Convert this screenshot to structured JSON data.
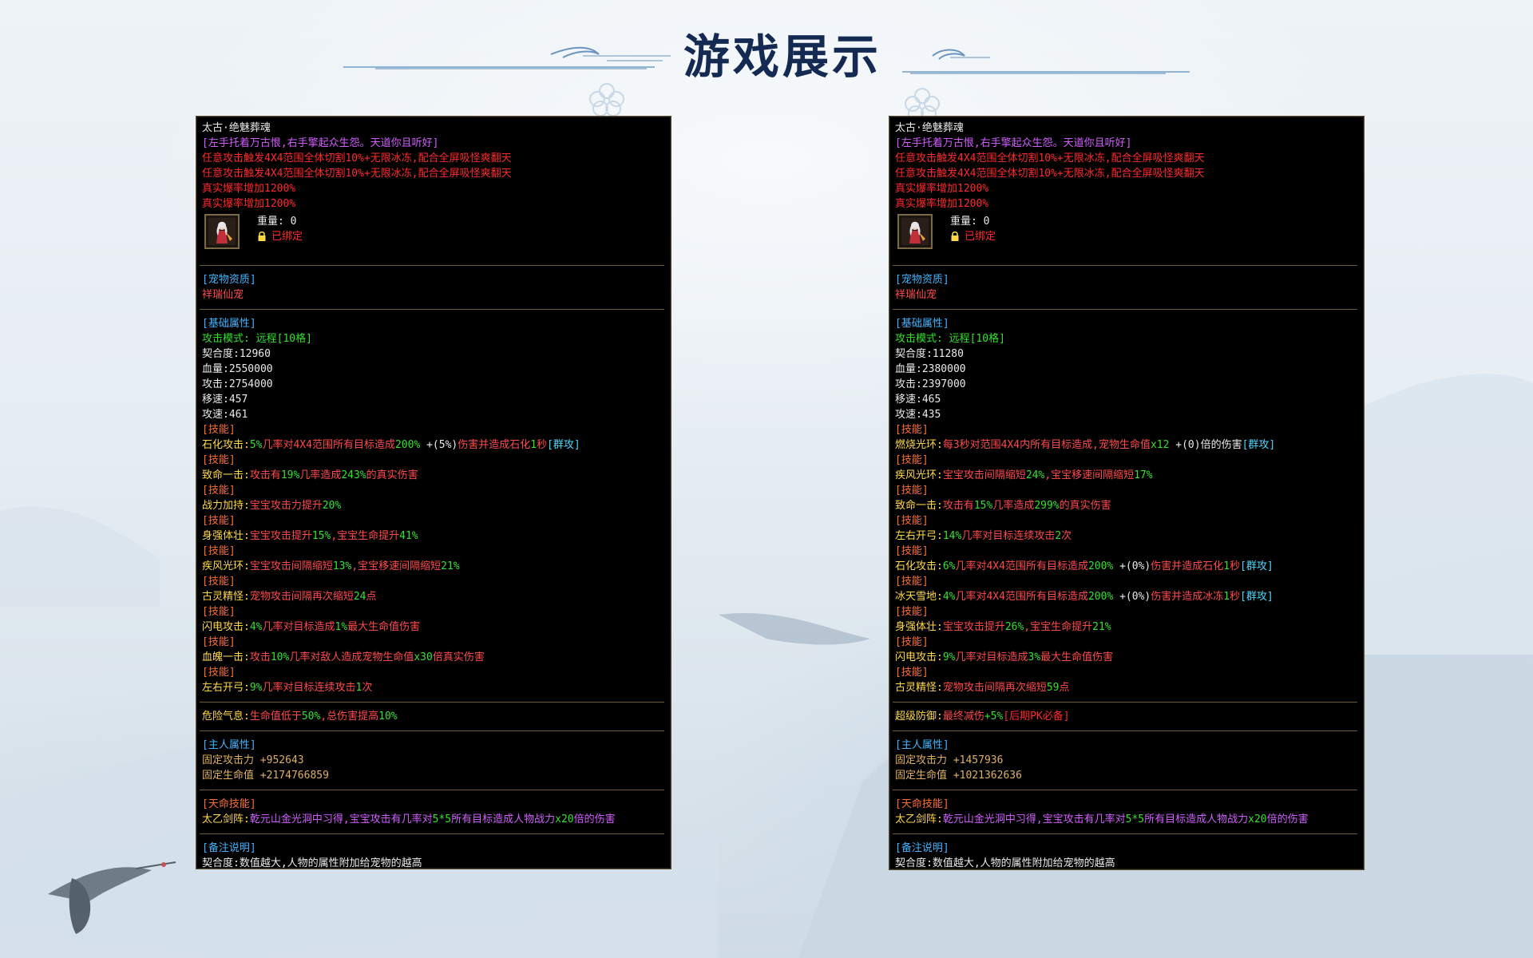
{
  "page_title": "游戏展示",
  "panels": [
    {
      "item_name": "太古·绝魅葬魂",
      "motto": "[左手托着万古恨,右手擎起众生怨。天道你且听好]",
      "effect_1": "任意攻击触发4X4范围全体切割10%+无限冰冻,配合全屏吸怪爽翻天",
      "effect_2": "任意攻击触发4X4范围全体切割10%+无限冰冻,配合全屏吸怪爽翻天",
      "crit_1": "真实爆率增加1200%",
      "crit_2": "真实爆率增加1200%",
      "weight_label": "重量: 0",
      "bound_label": "已绑定",
      "section_quality": "[宠物资质]",
      "quality_value": "祥瑞仙宠",
      "section_base": "[基础属性]",
      "attack_mode": "攻击模式: 远程[10格]",
      "stats": [
        "契合度:12960",
        "血量:2550000",
        "攻击:2754000",
        "移速:457",
        "攻速:461"
      ],
      "skill_label": "[技能]",
      "skills": [
        {
          "name": "石化攻击:",
          "p1": "5%",
          "t1": "几率对4X4范围所有目标造成",
          "p2": "200%",
          "t2": " +(5%)",
          "t3": "伤害并造成石化",
          "p3": "1",
          "t4": "秒",
          "tag": "[群攻]"
        },
        {
          "name": "致命一击:",
          "t1": "攻击有",
          "p1": "19%",
          "t2": "几率造成",
          "p2": "243%",
          "t3": "的真实伤害"
        },
        {
          "name": "战力加持:",
          "t1": "宝宝攻击力提升",
          "p1": "20%"
        },
        {
          "name": "身强体壮:",
          "t1": "宝宝攻击提升",
          "p1": "15%",
          "t2": ",宝宝生命提升",
          "p2": "41%"
        },
        {
          "name": "疾风光环:",
          "t1": "宝宝攻击间隔缩短",
          "p1": "13%",
          "t2": ",宝宝移速间隔缩短",
          "p2": "21%"
        },
        {
          "name": "古灵精怪:",
          "t1": "宠物攻击间隔再次缩短",
          "p1": "24",
          "t2": "点"
        },
        {
          "name": "闪电攻击:",
          "p1": "4%",
          "t1": "几率对目标造成",
          "p2": "1%",
          "t2": "最大生命值伤害"
        },
        {
          "name": "血魄一击:",
          "t1": "攻击",
          "p1": "10%",
          "t2": "几率对敌人造成宠物生命值",
          "p2": "x30",
          "t3": "倍真实伤害"
        },
        {
          "name": "左右开弓:",
          "p1": "9%",
          "t1": "几率对目标连续攻击",
          "p2": "1",
          "t2": "次"
        }
      ],
      "special": {
        "name": "危险气息:",
        "t1": "生命值低于",
        "p1": "50%",
        "t2": ",总伤害提高",
        "p2": "10%",
        "t3": ""
      },
      "section_owner": "[主人属性]",
      "owner_attack": "固定攻击力 +952643",
      "owner_hp": "固定生命值 +2174766859",
      "section_fate": "[天命技能]",
      "fate_name": "太乙剑阵:",
      "fate_text": "乾元山金光洞中习得,宝宝攻击有几率对",
      "fate_p1": "5*5",
      "fate_text2": "所有目标造成人物战力",
      "fate_p2": "x20",
      "fate_text3": "倍的伤害",
      "section_note": "[备注说明]",
      "note": "契合度:数值越大,人物的属性附加给宠物的越高"
    },
    {
      "item_name": "太古·绝魅葬魂",
      "motto": "[左手托着万古恨,右手擎起众生怨。天道你且听好]",
      "effect_1": "任意攻击触发4X4范围全体切割10%+无限冰冻,配合全屏吸怪爽翻天",
      "effect_2": "任意攻击触发4X4范围全体切割10%+无限冰冻,配合全屏吸怪爽翻天",
      "crit_1": "真实爆率增加1200%",
      "crit_2": "真实爆率增加1200%",
      "weight_label": "重量: 0",
      "bound_label": "已绑定",
      "section_quality": "[宠物资质]",
      "quality_value": "祥瑞仙宠",
      "section_base": "[基础属性]",
      "attack_mode": "攻击模式: 远程[10格]",
      "stats": [
        "契合度:11280",
        "血量:2380000",
        "攻击:2397000",
        "移速:465",
        "攻速:435"
      ],
      "skill_label": "[技能]",
      "skills": [
        {
          "name": "燃烧光环:",
          "t1": "每3秒对范围4X4内所有目标造成,宠物生命值",
          "p1": "x12",
          "t2": " +(0)倍的伤害",
          "tag": "[群攻]"
        },
        {
          "name": "疾风光环:",
          "t1": "宝宝攻击间隔缩短",
          "p1": "24%",
          "t2": ",宝宝移速间隔缩短",
          "p2": "17%"
        },
        {
          "name": "致命一击:",
          "t1": "攻击有",
          "p1": "15%",
          "t2": "几率造成",
          "p2": "299%",
          "t3": "的真实伤害"
        },
        {
          "name": "左右开弓:",
          "p1": "14%",
          "t1": "几率对目标连续攻击",
          "p2": "2",
          "t2": "次"
        },
        {
          "name": "石化攻击:",
          "p1": "6%",
          "t1": "几率对4X4范围所有目标造成",
          "p2": "200%",
          "t2": " +(0%)",
          "t3": "伤害并造成石化",
          "p3": "1",
          "t4": "秒",
          "tag": "[群攻]"
        },
        {
          "name": "冰天雪地:",
          "p1": "4%",
          "t1": "几率对4X4范围所有目标造成",
          "p2": "200%",
          "t2": " +(0%)",
          "t3": "伤害并造成冰冻",
          "p3": "1",
          "t4": "秒",
          "tag": "[群攻]"
        },
        {
          "name": "身强体壮:",
          "t1": "宝宝攻击提升",
          "p1": "26%",
          "t2": ",宝宝生命提升",
          "p2": "21%"
        },
        {
          "name": "闪电攻击:",
          "p1": "9%",
          "t1": "几率对目标造成",
          "p2": "3%",
          "t2": "最大生命值伤害"
        },
        {
          "name": "古灵精怪:",
          "t1": "宠物攻击间隔再次缩短",
          "p1": "59",
          "t2": "点"
        }
      ],
      "special": {
        "name": "超级防御:",
        "t1": "最终减伤",
        "p1": "+5%",
        "t2": "",
        "p2": "",
        "t3": "[后期PK必备]"
      },
      "section_owner": "[主人属性]",
      "owner_attack": "固定攻击力 +1457936",
      "owner_hp": "固定生命值 +1021362636",
      "section_fate": "[天命技能]",
      "fate_name": "太乙剑阵:",
      "fate_text": "乾元山金光洞中习得,宝宝攻击有几率对",
      "fate_p1": "5*5",
      "fate_text2": "所有目标造成人物战力",
      "fate_p2": "x20",
      "fate_text3": "倍的伤害",
      "section_note": "[备注说明]",
      "note": "契合度:数值越大,人物的属性附加给宠物的越高"
    }
  ]
}
